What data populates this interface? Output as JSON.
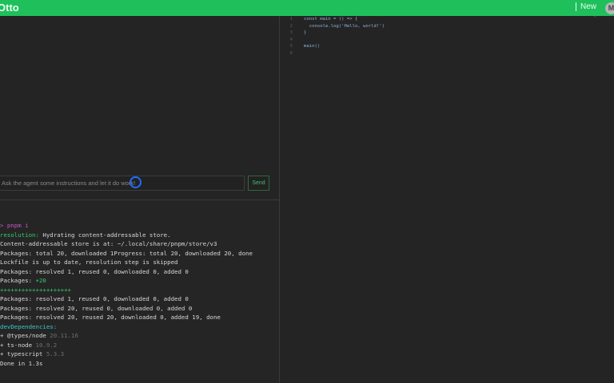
{
  "app": {
    "title": "Otto",
    "new_label": "New",
    "avatar_initial": "M"
  },
  "chat": {
    "input_value": "Ask the agent some instructions and let it do work!",
    "send_label": "Send"
  },
  "terminal": {
    "lines": [
      {
        "text": "> pnpm i",
        "color": "magenta"
      },
      {
        "prefix": "resolution:",
        "text": " Hydrating content-addressable store.",
        "prefix_color": "green"
      },
      {
        "text": "Content-addressable store is at: ~/.local/share/pnpm/store/v3"
      },
      {
        "prefix": "Packages:",
        "text": " total 20, downloaded 1Progress: total 20, downloaded 20, done",
        "prefix_color": "white"
      },
      {
        "text": "Lockfile is up to date, resolution step is skipped"
      },
      {
        "prefix": "Packages:",
        "text": " resolved 1, reused 0, downloaded 0, added 0"
      },
      {
        "prefix": "Packages:",
        "text": " +20",
        "text_color": "green"
      },
      {
        "text": "++++++++++++++++++++",
        "color": "green"
      },
      {
        "prefix": "Packages:",
        "text": " resolved 1, reused 0, downloaded 0, added 0"
      },
      {
        "prefix": "Packages:",
        "text": " resolved 20, reused 0, downloaded 0, added 0"
      },
      {
        "prefix": "Packages:",
        "text": " resolved 20, reused 20, downloaded 0, added 19, done"
      },
      {
        "text": "devDependencies:",
        "color": "cyan"
      },
      {
        "text": "+ @types/node",
        "suffix": " 20.11.16"
      },
      {
        "text": "+ ts-node",
        "suffix": " 10.9.2"
      },
      {
        "text": "+ typescript",
        "suffix": " 5.3.3"
      },
      {
        "text": "Done in 1.3s"
      }
    ]
  },
  "editor": {
    "lines": [
      {
        "num": "1",
        "text": "const main = () => {"
      },
      {
        "num": "2",
        "text": "  console.log('Hello, world!')"
      },
      {
        "num": "3",
        "text": "}"
      },
      {
        "num": "4",
        "text": ""
      },
      {
        "num": "5",
        "text": "main()"
      },
      {
        "num": "6",
        "text": ""
      }
    ]
  }
}
